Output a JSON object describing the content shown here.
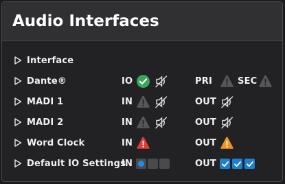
{
  "title": "Audio Interfaces",
  "colors": {
    "ok": "#3aa55a",
    "error": "#e23b3b",
    "warning": "#f0931e",
    "inactive": "#57575b",
    "accent": "#1d7fd0"
  },
  "header_row": {
    "label": "Interface"
  },
  "rows": [
    {
      "label": "Dante®",
      "in_label": "IO",
      "in_icons": [
        "check-circle-icon",
        "no-signal-icon"
      ],
      "out_label": "PRI",
      "out_icons": [
        "warning-gray-icon"
      ],
      "sec_label": "SEC",
      "sec_icon": "warning-gray-icon"
    },
    {
      "label": "MADI 1",
      "in_label": "IN",
      "in_icons": [
        "warning-gray-icon",
        "no-signal-icon"
      ],
      "out_label": "OUT",
      "out_icons": [
        "no-signal-icon"
      ]
    },
    {
      "label": "MADI 2",
      "in_label": "IN",
      "in_icons": [
        "warning-gray-icon",
        "no-signal-icon"
      ],
      "out_label": "OUT",
      "out_icons": [
        "no-signal-icon"
      ]
    },
    {
      "label": "Word Clock",
      "in_label": "IN",
      "in_icons": [
        "warning-red-icon"
      ],
      "out_label": "OUT",
      "out_icons": [
        "warning-orange-icon"
      ]
    },
    {
      "label": "Default IO Settings",
      "in_label": "IN",
      "in_selector": [
        "selected",
        "empty",
        "empty"
      ],
      "out_label": "OUT",
      "out_checks": [
        true,
        true,
        true
      ]
    }
  ]
}
